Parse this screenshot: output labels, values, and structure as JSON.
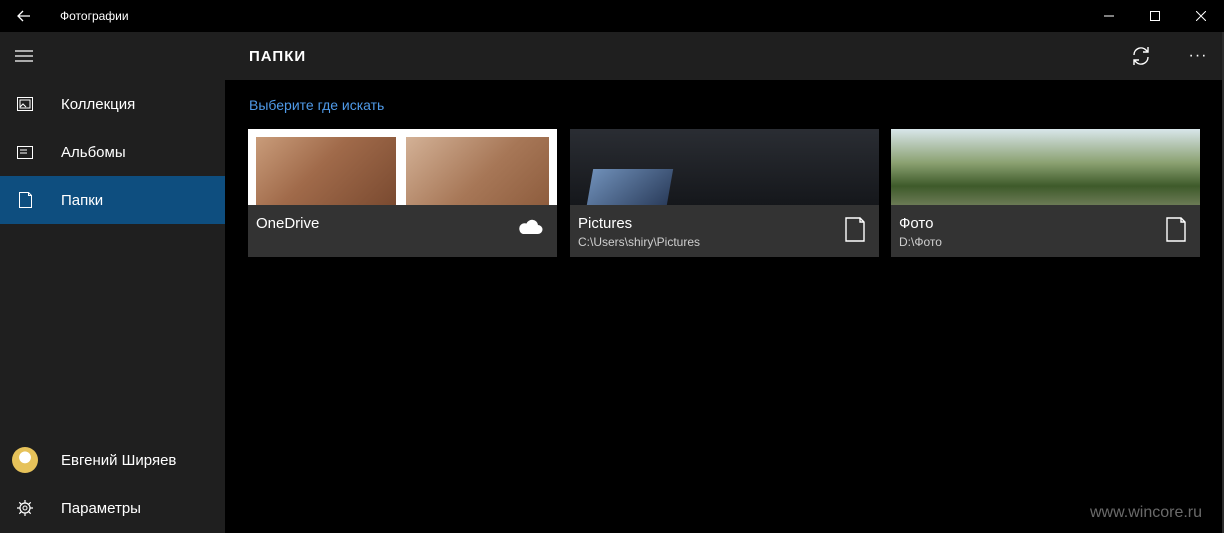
{
  "window": {
    "title": "Фотографии"
  },
  "sidebar": {
    "items": [
      {
        "label": "Коллекция",
        "icon": "collection-icon"
      },
      {
        "label": "Альбомы",
        "icon": "album-icon"
      },
      {
        "label": "Папки",
        "icon": "folder-icon",
        "active": true
      }
    ],
    "user": {
      "name": "Евгений Ширяев"
    },
    "settings": {
      "label": "Параметры"
    }
  },
  "header": {
    "title": "ПАПКИ"
  },
  "main": {
    "choose_link": "Выберите где искать",
    "folders": [
      {
        "name": "OneDrive",
        "path": "",
        "icon": "cloud-icon"
      },
      {
        "name": "Pictures",
        "path": "C:\\Users\\shiry\\Pictures",
        "icon": "folder-outline-icon"
      },
      {
        "name": "Фото",
        "path": "D:\\Фото",
        "icon": "folder-outline-icon"
      }
    ]
  },
  "watermark": "www.wincore.ru",
  "colors": {
    "accent": "#0e4e7f",
    "link": "#4f9ae8",
    "sidebar": "#1f1f1f",
    "tile": "#333333"
  }
}
